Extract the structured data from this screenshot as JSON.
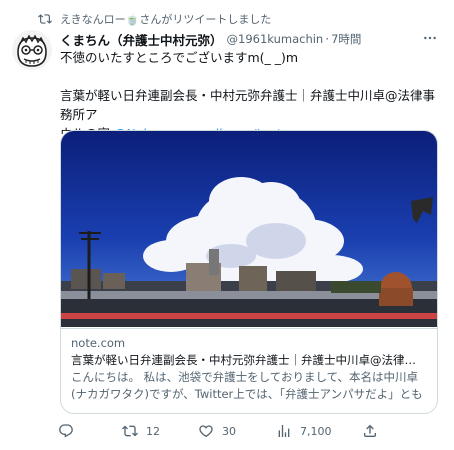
{
  "retweet": {
    "text": "えきなんロー🍵さんがリツイートしました"
  },
  "tweet": {
    "author_name": "くまちん（弁護士中村元弥）",
    "handle": "@1961kumachin",
    "separator": "·",
    "time": "7時間",
    "line1": "不徳のいたすところでございますm(_ _)m",
    "line2": "言葉が軽い日弁連副会長・中村元弥弁護士｜弁護士中川卓@法律事務所ア",
    "line3_text": "ウルの家 ",
    "line3_link": "@Nakagawa_owlhom #note"
  },
  "card": {
    "domain": "note.com",
    "title": "言葉が軽い日弁連副会長・中村元弥弁護士｜弁護士中川卓@法律事務...",
    "description": "こんにちは。 私は、池袋で弁護士をしておりまして、本名は中川卓(ナカガワタク)ですが、Twitter上では、「弁護士アンパサだよ」とも名..."
  },
  "actions": {
    "replies": "",
    "retweets": "12",
    "likes": "30",
    "views": "7,100"
  },
  "icons": {
    "retweet_header": "retweet-icon",
    "more": "more-icon",
    "reply": "reply-icon",
    "retweet": "retweet-icon",
    "like": "heart-icon",
    "views": "views-icon",
    "share": "share-icon"
  },
  "colors": {
    "accent": "#1d9bf0",
    "secondary_text": "#536471",
    "border": "#cfd9de"
  }
}
